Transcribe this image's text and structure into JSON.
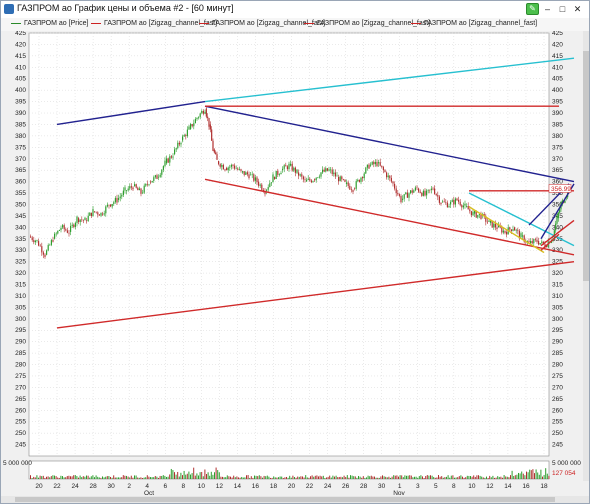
{
  "window": {
    "title": "ГАЗПРОМ ао График цены и объема #2 - [60 минут]",
    "buttons": {
      "pen": "✎",
      "minimize": "–",
      "maximize": "□",
      "close": "✕"
    }
  },
  "legend": [
    {
      "label": "ГАЗПРОМ ао [Price]",
      "color": "#2a8a2a"
    },
    {
      "label": "ГАЗПРОМ ао [Zigzag_channel_fast]",
      "color": "#c22"
    },
    {
      "label": "ГАЗПРОМ ао [Zigzag_channel_fast]",
      "color": "#c22"
    },
    {
      "label": "ГАЗПРОМ ао [Zigzag_channel_fast]",
      "color": "#c22"
    },
    {
      "label": "ГАЗПРОМ ао [Zigzag_channel_fast]",
      "color": "#c22"
    }
  ],
  "colors": {
    "up_candle": "#2e9e2e",
    "down_candle": "#b03030",
    "grid": "#d5d5d5"
  },
  "chart_data": {
    "type": "candlestick",
    "price_axis": {
      "min": 240,
      "max": 425,
      "step": 5
    },
    "price_ticks": [
      "425",
      "420",
      "415",
      "410",
      "405",
      "400",
      "395",
      "390",
      "385",
      "380",
      "375",
      "370",
      "365",
      "360",
      "355",
      "350",
      "345",
      "340",
      "335",
      "330",
      "325",
      "320",
      "315",
      "310",
      "305",
      "300",
      "295",
      "290",
      "285",
      "280",
      "275",
      "270",
      "265",
      "260",
      "255",
      "250",
      "245"
    ],
    "current_price_label": "356.99",
    "volume_axis": {
      "labels": [
        "5 000 000"
      ],
      "right_label": "5 000 000",
      "current_label": "127 054"
    },
    "date_ticks": [
      "20",
      "22",
      "24",
      "28",
      "30",
      "2",
      "4",
      "6",
      "8",
      "10",
      "12",
      "14",
      "16",
      "18",
      "20",
      "22",
      "24",
      "26",
      "28",
      "30",
      "1",
      "3",
      "5",
      "8",
      "10",
      "12",
      "14",
      "16",
      "18"
    ],
    "month_labels": [
      "Oct",
      "Nov"
    ],
    "price_series": [
      [
        0,
        336
      ],
      [
        8,
        334
      ],
      [
        16,
        328
      ],
      [
        24,
        335
      ],
      [
        32,
        340
      ],
      [
        40,
        338
      ],
      [
        48,
        344
      ],
      [
        56,
        343
      ],
      [
        64,
        347
      ],
      [
        72,
        346
      ],
      [
        80,
        350
      ],
      [
        88,
        352
      ],
      [
        96,
        356
      ],
      [
        104,
        358
      ],
      [
        112,
        355
      ],
      [
        120,
        360
      ],
      [
        128,
        362
      ],
      [
        136,
        368
      ],
      [
        144,
        372
      ],
      [
        152,
        378
      ],
      [
        160,
        383
      ],
      [
        168,
        388
      ],
      [
        176,
        392
      ],
      [
        180,
        385
      ],
      [
        184,
        374
      ],
      [
        188,
        369
      ],
      [
        196,
        366
      ],
      [
        204,
        367
      ],
      [
        212,
        364
      ],
      [
        220,
        363
      ],
      [
        228,
        360
      ],
      [
        236,
        356
      ],
      [
        244,
        362
      ],
      [
        252,
        365
      ],
      [
        260,
        367
      ],
      [
        268,
        364
      ],
      [
        276,
        360
      ],
      [
        284,
        361
      ],
      [
        292,
        364
      ],
      [
        300,
        365
      ],
      [
        308,
        362
      ],
      [
        316,
        359
      ],
      [
        324,
        357
      ],
      [
        332,
        362
      ],
      [
        340,
        367
      ],
      [
        348,
        368
      ],
      [
        356,
        364
      ],
      [
        364,
        359
      ],
      [
        372,
        352
      ],
      [
        380,
        355
      ],
      [
        388,
        357
      ],
      [
        396,
        354
      ],
      [
        404,
        357
      ],
      [
        412,
        351
      ],
      [
        420,
        350
      ],
      [
        428,
        352
      ],
      [
        436,
        349
      ],
      [
        444,
        346
      ],
      [
        452,
        345
      ],
      [
        460,
        342
      ],
      [
        468,
        340
      ],
      [
        476,
        338
      ],
      [
        484,
        340
      ],
      [
        492,
        336
      ],
      [
        500,
        333
      ],
      [
        508,
        334
      ],
      [
        516,
        332
      ],
      [
        524,
        336
      ],
      [
        528,
        344
      ],
      [
        532,
        350
      ],
      [
        536,
        353
      ],
      [
        540,
        357
      ]
    ],
    "lines": [
      {
        "color": "#27c0d0",
        "p1": [
          176,
          395
        ],
        "p2": [
          545,
          414
        ]
      },
      {
        "color": "#22228f",
        "p1": [
          28,
          385
        ],
        "p2": [
          176,
          395
        ]
      },
      {
        "color": "#22228f",
        "p1": [
          176,
          393
        ],
        "p2": [
          545,
          360
        ]
      },
      {
        "color": "#d02a2a",
        "p1": [
          176,
          393
        ],
        "p2": [
          530,
          393
        ]
      },
      {
        "color": "#d02a2a",
        "p1": [
          176,
          361
        ],
        "p2": [
          545,
          328
        ]
      },
      {
        "color": "#d02a2a",
        "p1": [
          28,
          296
        ],
        "p2": [
          545,
          325
        ]
      },
      {
        "color": "#d02a2a",
        "p1": [
          440,
          356
        ],
        "p2": [
          545,
          356
        ]
      },
      {
        "color": "#27c0d0",
        "p1": [
          440,
          355
        ],
        "p2": [
          545,
          332
        ]
      },
      {
        "color": "#d8c020",
        "p1": [
          440,
          349
        ],
        "p2": [
          515,
          329
        ]
      },
      {
        "color": "#22228f",
        "p1": [
          500,
          341
        ],
        "p2": [
          540,
          359
        ]
      },
      {
        "color": "#22228f",
        "p1": [
          512,
          335
        ],
        "p2": [
          545,
          359
        ]
      },
      {
        "color": "#d02a2a",
        "p1": [
          512,
          332
        ],
        "p2": [
          545,
          343
        ]
      },
      {
        "color": "#d02a2a",
        "p1": [
          512,
          330
        ],
        "p2": [
          530,
          337
        ]
      }
    ]
  }
}
